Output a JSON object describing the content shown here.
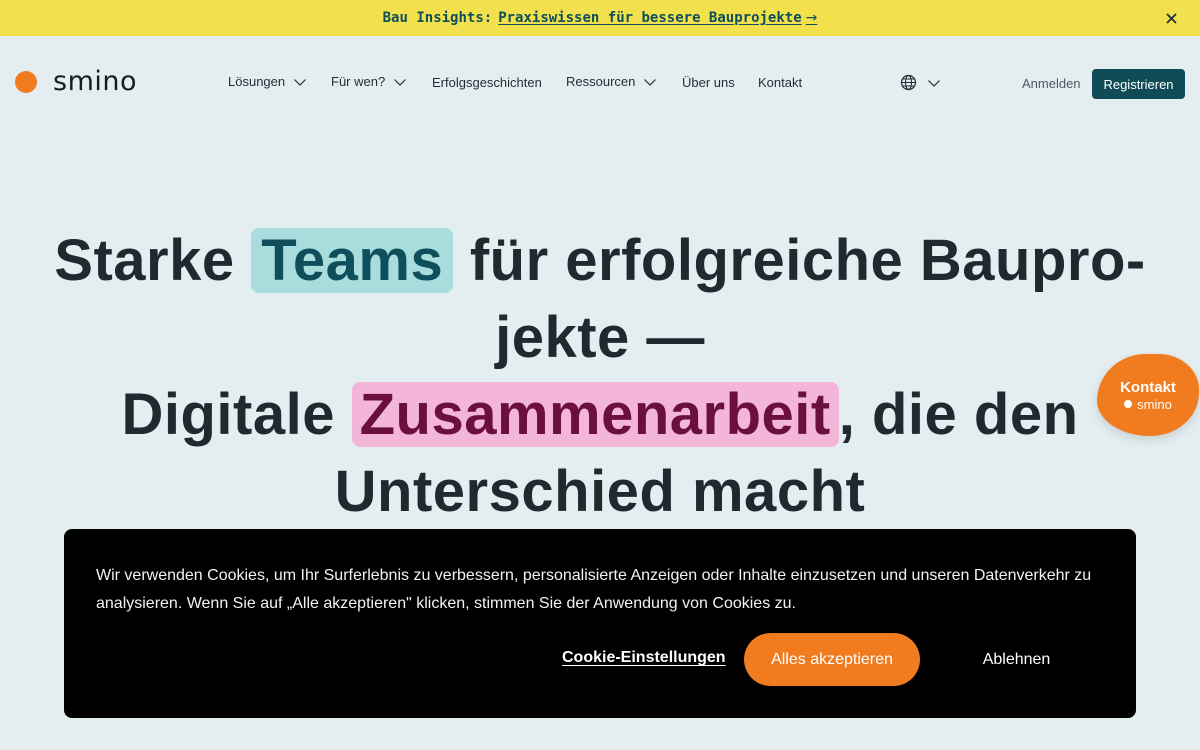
{
  "announcement": {
    "lead": "Bau Insights:",
    "link": "Praxiswissen für bessere Bauprojekte",
    "arrow": "→",
    "close_icon": "close-icon"
  },
  "header": {
    "logo_text": "smino",
    "nav": [
      {
        "label": "Lösungen",
        "has_dropdown": true
      },
      {
        "label": "Für wen?",
        "has_dropdown": true
      },
      {
        "label": "Erfolgsgeschichten",
        "has_dropdown": false
      },
      {
        "label": "Ressourcen",
        "has_dropdown": true
      },
      {
        "label": "Über uns",
        "has_dropdown": false
      },
      {
        "label": "Kontakt",
        "has_dropdown": false
      }
    ],
    "language_icon": "globe-icon",
    "login_label": "Anmelden",
    "register_label": "Registrieren"
  },
  "hero": {
    "part1": "Starke ",
    "highlight1": "Teams",
    "part2": " für erfolgreiche Baupro-jekte —",
    "part3": "Digitale ",
    "highlight2": "Zusammenarbeit",
    "part4": ", die den Unterschied macht"
  },
  "contact_widget": {
    "title": "Kontakt",
    "brand": "smino"
  },
  "cookie_banner": {
    "text": "Wir verwenden Cookies, um Ihr Surferlebnis zu verbessern, personalisierte Anzeigen oder Inhalte einzusetzen und unseren Datenverkehr zu analysieren. Wenn Sie auf „Alle akzeptieren\" klicken, stimmen Sie der Anwendung von Cookies zu.",
    "settings_label": "Cookie-Einstellungen",
    "accept_label": "Alles akzeptieren",
    "decline_label": "Ablehnen"
  },
  "colors": {
    "announcement_bg": "#f2e04d",
    "brand_orange": "#f07c1f",
    "brand_teal": "#0f4c58",
    "page_bg": "#e4eef1",
    "highlight_teal": "#a8dcdd",
    "highlight_pink": "#f4b6d8"
  }
}
